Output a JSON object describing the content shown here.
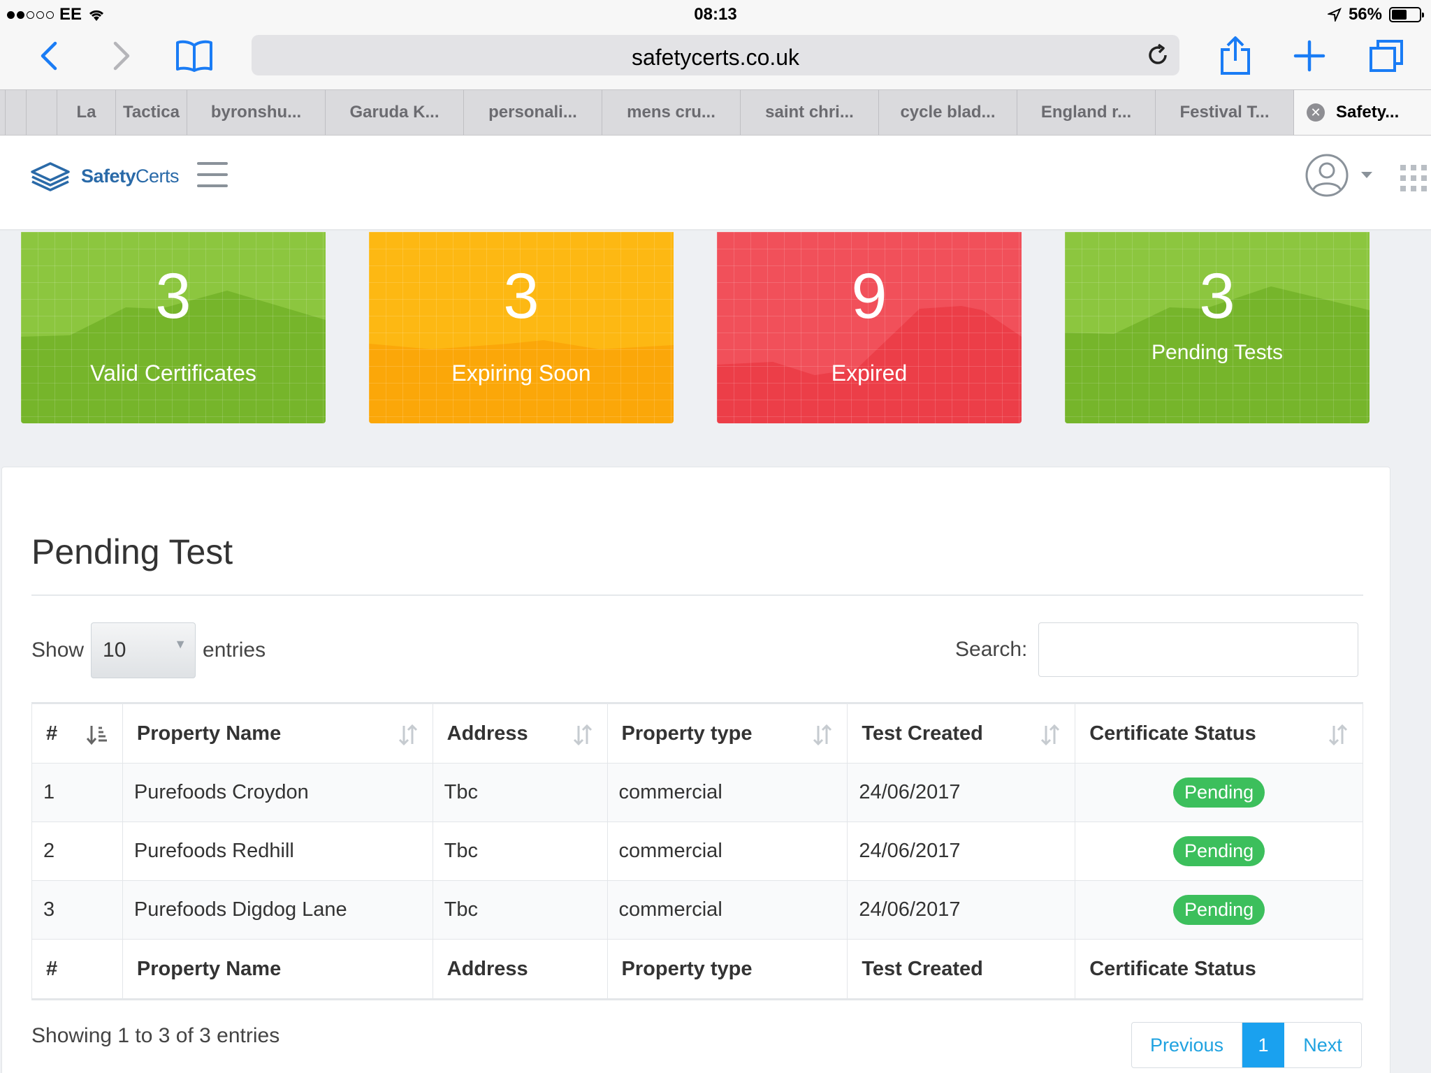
{
  "statusbar": {
    "carrier": "EE",
    "time": "08:13",
    "battery": "56%"
  },
  "browser": {
    "url": "safetycerts.co.uk",
    "tabs": [
      "La",
      "Tactica",
      "byronshu...",
      "Garuda K...",
      "personali...",
      "mens cru...",
      "saint chri...",
      "cycle blad...",
      "England r...",
      "Festival T...",
      "Safety..."
    ]
  },
  "app": {
    "logo_bold": "Safety",
    "logo_rest": "Certs"
  },
  "tiles": [
    {
      "value": "3",
      "label": "Valid Certificates",
      "color": "#8cc63f"
    },
    {
      "value": "3",
      "label": "Expiring Soon",
      "color": "#fdb813"
    },
    {
      "value": "9",
      "label": "Expired",
      "color": "#f1505a"
    },
    {
      "value": "3",
      "label": "Pending Tests",
      "color": "#8cc63f"
    }
  ],
  "panel": {
    "title": "Pending Test",
    "show_label": "Show",
    "page_size": "10",
    "entries_label": "entries",
    "search_label": "Search:",
    "columns": [
      "#",
      "Property Name",
      "Address",
      "Property type",
      "Test Created",
      "Certificate Status"
    ],
    "rows": [
      {
        "num": "1",
        "name": "Purefoods Croydon",
        "address": "Tbc",
        "type": "commercial",
        "created": "24/06/2017",
        "status": "Pending"
      },
      {
        "num": "2",
        "name": "Purefoods Redhill",
        "address": "Tbc",
        "type": "commercial",
        "created": "24/06/2017",
        "status": "Pending"
      },
      {
        "num": "3",
        "name": "Purefoods Digdog Lane",
        "address": "Tbc",
        "type": "commercial",
        "created": "24/06/2017",
        "status": "Pending"
      }
    ],
    "info": "Showing 1 to 3 of 3 entries",
    "pager": {
      "prev": "Previous",
      "current": "1",
      "next": "Next"
    }
  }
}
